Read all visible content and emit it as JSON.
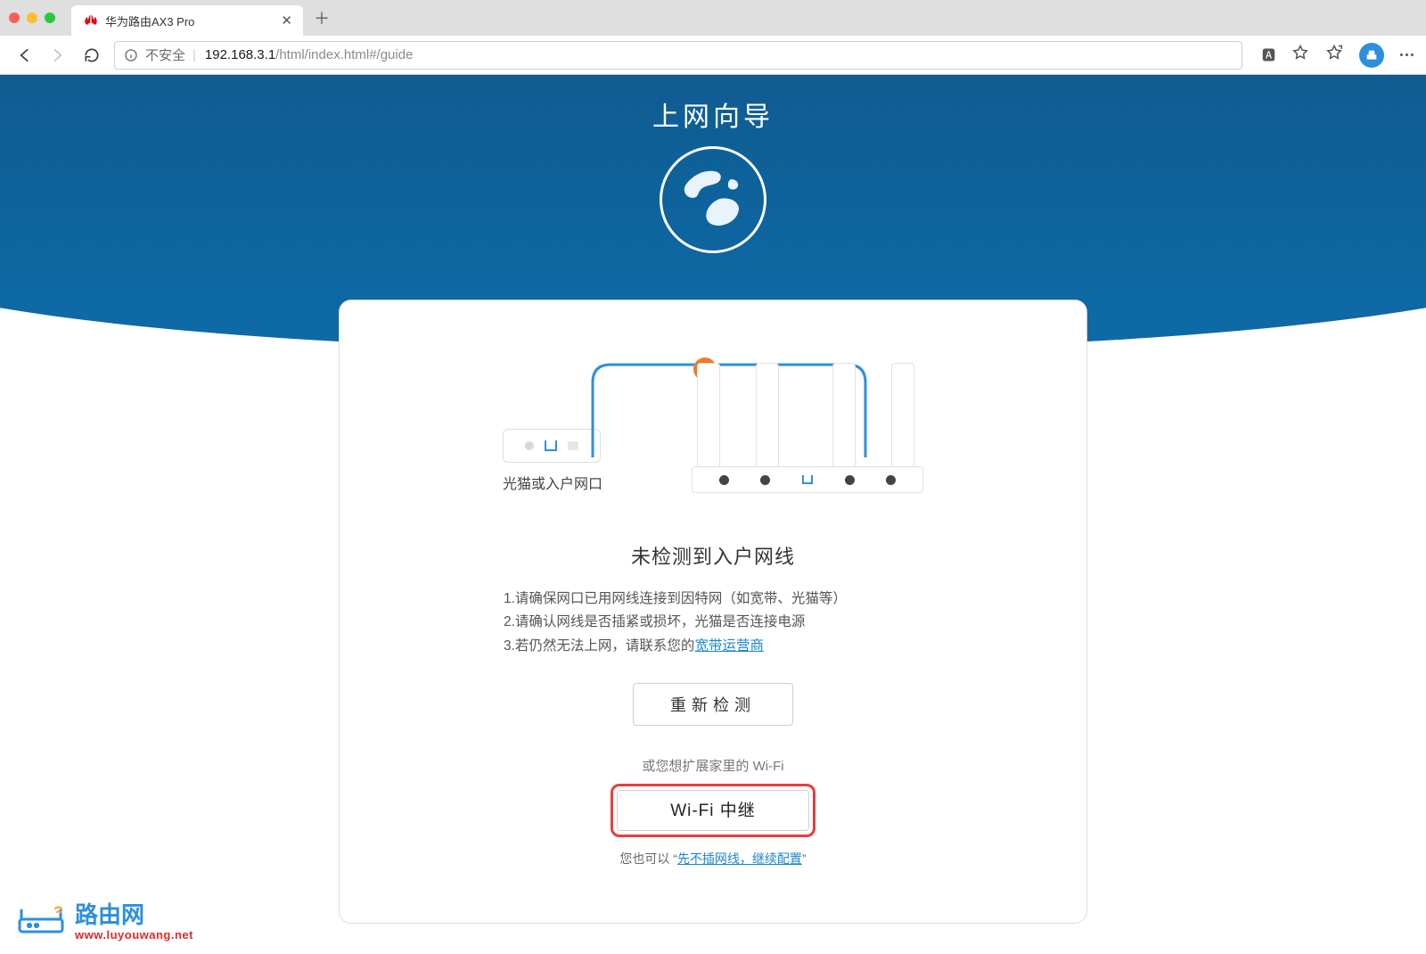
{
  "browser": {
    "tab_title": "华为路由AX3 Pro",
    "security_label": "不安全",
    "url_host": "192.168.3.1",
    "url_path": "/html/index.html#/guide"
  },
  "header": {
    "title": "上网向导"
  },
  "diagram": {
    "modem_label": "光猫或入户网口"
  },
  "status": {
    "title": "未检测到入户网线",
    "tip1": "1.请确保网口已用网线连接到因特网（如宽带、光猫等）",
    "tip2": "2.请确认网线是否插紧或损坏，光猫是否连接电源",
    "tip3_prefix": "3.若仍然无法上网，请联系您的",
    "tip3_link": "宽带运营商"
  },
  "buttons": {
    "redetect": "重新检测",
    "extend_hint": "或您想扩展家里的 Wi-Fi",
    "wifi_relay": "Wi-Fi 中继",
    "alt_prefix": "您也可以 “",
    "alt_link": "先不插网线，继续配置",
    "alt_suffix": "”"
  },
  "watermark": {
    "brand": "路由网",
    "url": "www.luyouwang.net"
  }
}
